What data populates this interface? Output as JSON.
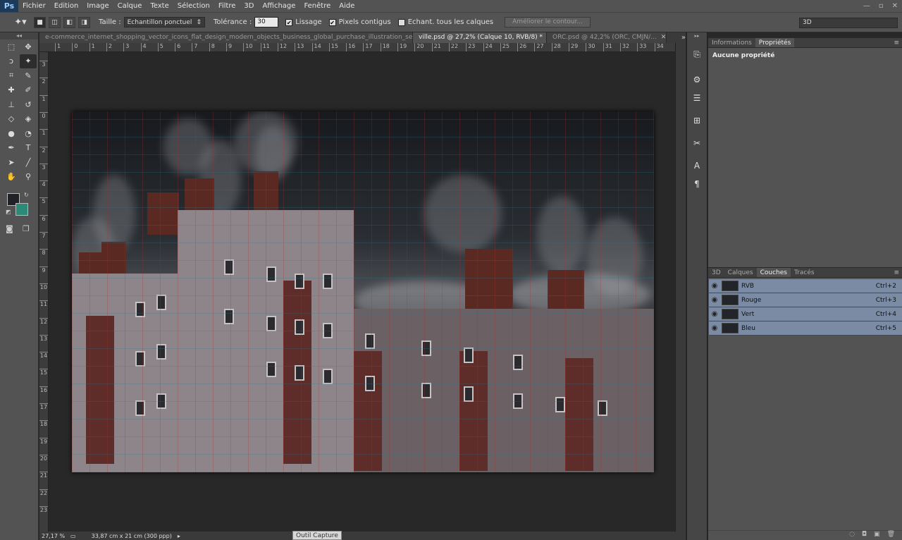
{
  "menubar": {
    "logo": "Ps",
    "items": [
      "Fichier",
      "Edition",
      "Image",
      "Calque",
      "Texte",
      "Sélection",
      "Filtre",
      "3D",
      "Affichage",
      "Fenêtre",
      "Aide"
    ],
    "window_controls": [
      "—",
      "▫",
      "✕"
    ]
  },
  "options": {
    "tool_icon": "magic-wand",
    "size_label": "Taille :",
    "size_value": "Echantillon ponctuel",
    "tolerance_label": "Tolérance :",
    "tolerance_value": "30",
    "lissage": "Lissage",
    "contigus": "Pixels contigus",
    "all_layers": "Echant. tous les calques",
    "refine_button": "Améliorer le contour...",
    "workspace": "3D"
  },
  "tabs": [
    {
      "label": "e-commerce_internet_shopping_vector_icons_flat_design_modern_objects_business_global_purchase_illustration_set.psd",
      "close": "✕"
    },
    {
      "label": "ville.psd @ 27,2% (Calque 10, RVB/8) *",
      "close": "✕"
    },
    {
      "label": "ORC.psd @ 42,2% (ORC, CMJN/...",
      "close": "✕"
    }
  ],
  "tabs_overflow": "»",
  "ruler_top": [
    "1",
    "0",
    "1",
    "2",
    "3",
    "4",
    "5",
    "6",
    "7",
    "8",
    "9",
    "10",
    "11",
    "12",
    "13",
    "14",
    "15",
    "16",
    "17",
    "18",
    "19",
    "20",
    "21",
    "22",
    "23",
    "24",
    "25",
    "26",
    "27",
    "28",
    "29",
    "30",
    "31",
    "32",
    "33",
    "34"
  ],
  "ruler_left": [
    "3",
    "2",
    "1",
    "0",
    "1",
    "2",
    "3",
    "4",
    "5",
    "6",
    "7",
    "8",
    "9",
    "10",
    "11",
    "12",
    "13",
    "14",
    "15",
    "16",
    "17",
    "18",
    "19",
    "20",
    "21",
    "22",
    "23"
  ],
  "status": {
    "zoom": "27,17 %",
    "doc_size": "33,87 cm x 21 cm (300 ppp)",
    "arrow": "▸",
    "tooltip": "Outil Capture"
  },
  "properties": {
    "tabs": [
      "Informations",
      "Propriétés"
    ],
    "empty": "Aucune propriété"
  },
  "layers": {
    "tabs": [
      "3D",
      "Calques",
      "Couches",
      "Tracés"
    ],
    "channels": [
      {
        "name": "RVB",
        "key": "Ctrl+2"
      },
      {
        "name": "Rouge",
        "key": "Ctrl+3"
      },
      {
        "name": "Vert",
        "key": "Ctrl+4"
      },
      {
        "name": "Bleu",
        "key": "Ctrl+5"
      }
    ]
  },
  "colors": {
    "foreground": "#1f2328",
    "background": "#2d8a78"
  }
}
